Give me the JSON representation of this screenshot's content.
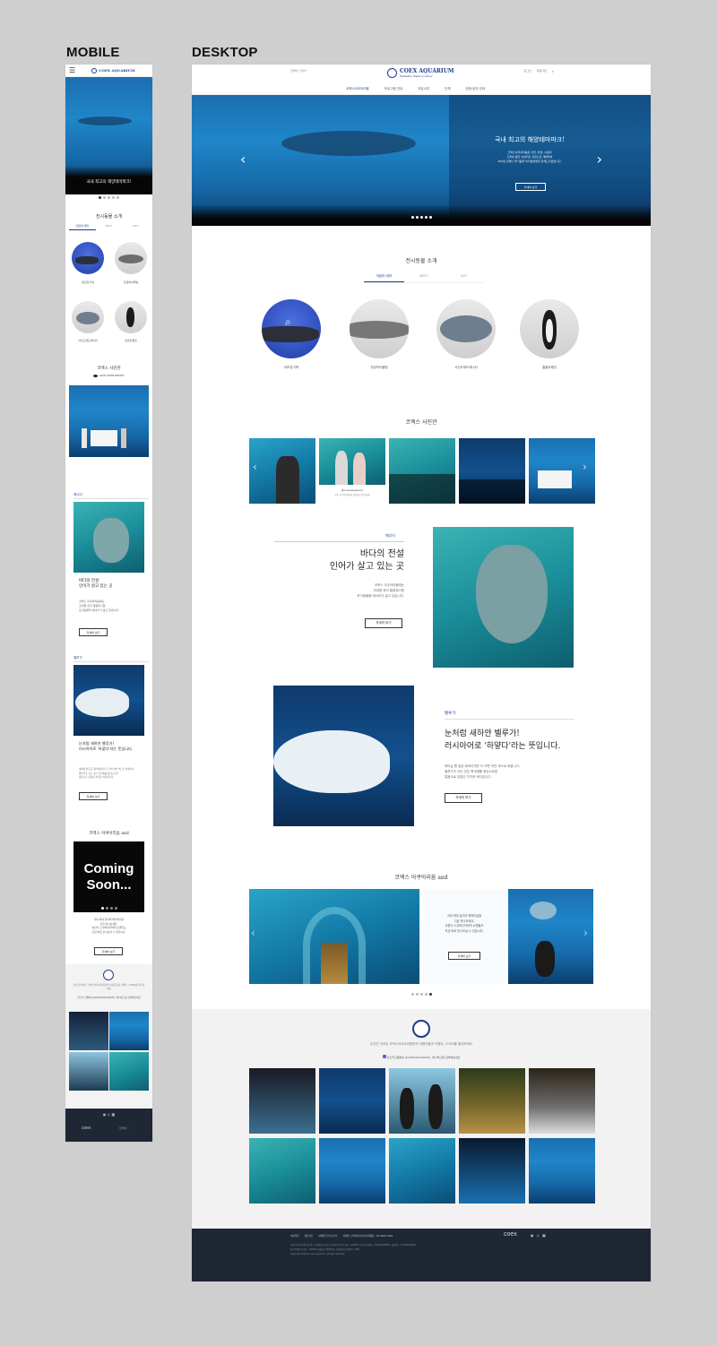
{
  "boards": {
    "mobile": "MOBILE",
    "desktop": "DESKTOP"
  },
  "brand": {
    "name": "COEX AQUARIUM",
    "tagline": "Fantastic Water Journey",
    "accent": "#1a3b8c"
  },
  "header": {
    "lang": "한국어 / 언어",
    "util": [
      "로그인",
      "회원가입"
    ],
    "nav": [
      "코엑스아쿠아리움",
      "프로그램 안내",
      "커뮤니티",
      "단체",
      "방문/공지 안내"
    ]
  },
  "hero": {
    "title": "국내 최고의 해양테마파크!",
    "desc": [
      "코엑스아쿠아리움은 자연, 환경, 사람이",
      "조화를 통한 녹생적인 관점으로 개방하여",
      "365일 언제나 즐거움을 여러분들에게 전해드리겠습니다."
    ],
    "button": "자세히 보기",
    "dots": 5,
    "active_dot": 1
  },
  "animals": {
    "title": "전시동물 소개",
    "tabs": [
      "이달의 테마",
      "BEST",
      "GIFT"
    ],
    "items": [
      {
        "name": "대모장거북"
      },
      {
        "name": "잔점박이물범"
      },
      {
        "name": "서인도제도매너티"
      },
      {
        "name": "훔볼트펭귄"
      }
    ]
  },
  "photo_studio": {
    "title": "코엑스 사진관",
    "hashtag": "ADD YOUR PHOTO",
    "caption": "@coexaquarium",
    "caption_sub": "코엑스아쿠아리움에서 인생샷을 남겨보세요"
  },
  "feature1": {
    "label": "매너티",
    "title_lines": [
      "바다의 전설",
      "인어가 살고 있는 곳"
    ],
    "desc": [
      "코엑스 아쿠아리움에는",
      "초대형 희귀 멸종위기종",
      "포식동물을 매너티가 살고 있습니다."
    ],
    "button": "자세히 보기"
  },
  "feature2": {
    "label": "벨루가",
    "title_lines": [
      "눈처럼 새하얀 벨루가!",
      "러시아어로 '하얗다'라는 뜻입니다."
    ],
    "desc": [
      "태어날 땐 둥은 회색이지만 다 크면 하얀 색으로 바뀝니다.",
      "벨루가가 사는 곳은 북극해를 중심으로한",
      "얼음으로 뒤덮인 차가운 바다입니다."
    ],
    "button": "자세히 보기"
  },
  "and_section": {
    "title": "코엑스 아쿠아리움 and",
    "coming": [
      "Coming",
      "Soon..."
    ],
    "desc": [
      "국내 최대 길이의 해저터널을",
      "지금 만나보세요.",
      "속한다 스쿠버다이버의 쇼핸들도",
      "지금 바로 만나보실 수 있습니다."
    ],
    "button": "자세히 보기",
    "dots": 5,
    "active_dot": 4
  },
  "instagram": {
    "text": "수년간 이어온 코엑스아쿠아리움만의 아름다움과 이벤트, COEX를 즐겨보세요",
    "handle": "인스타그램에서 @COEXAQUARIUM_ 해시태그를 검색해보세요"
  },
  "footer": {
    "links": [
      "이용약관",
      "개인정보",
      "이메일무단수집거부",
      "이메일 고객센터(문의)/인재채용 : 02-6000-7000"
    ],
    "info1": "코엑스아쿠아리움 ㈜코엑스 서울특별시 강남구 영동대로 513 | 대표 : 00000 | 사업자등록번호 : 000-00-00000 | 대표번호 : 02-6002-6200",
    "info2": "통신판매업신고번호 : 제0000-서울강남-00000호 | 개인정보보호책임자 : 000",
    "copyright": "copyright 2019 by coex aquarium. all right reserved.",
    "logo": "coex",
    "mobile_lang": "한국어"
  },
  "colors": {
    "navy_footer": "#1f2634",
    "ocean": "#1f86c9"
  },
  "icons": [
    "menu-icon",
    "search-icon",
    "chevron-left-icon",
    "chevron-right-icon",
    "instagram-icon",
    "facebook-icon",
    "youtube-icon"
  ]
}
